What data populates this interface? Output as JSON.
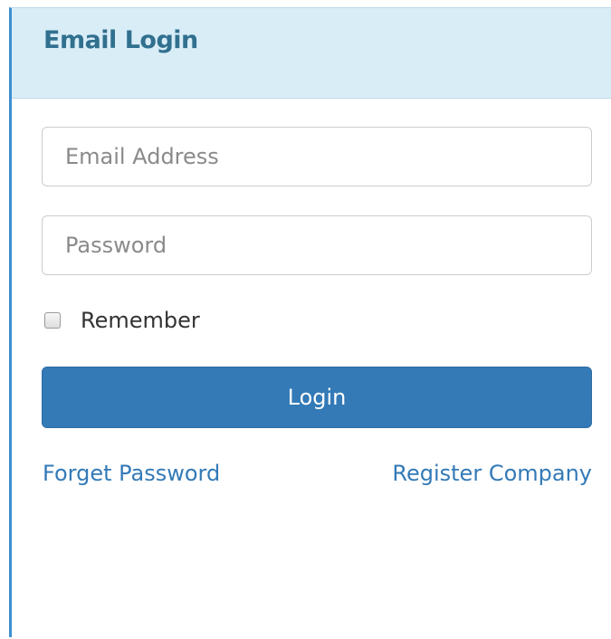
{
  "panel": {
    "title": "Email Login"
  },
  "form": {
    "email_placeholder": "Email Address",
    "password_placeholder": "Password",
    "remember_label": "Remember",
    "remember_checked": false,
    "login_label": "Login"
  },
  "links": {
    "forget_password": "Forget Password",
    "register_company": "Register Company"
  },
  "colors": {
    "heading_background": "#d9edf7",
    "heading_text": "#31708f",
    "primary_button": "#337ab7",
    "link_text": "#337ab7",
    "panel_accent_border": "#3d8fd1"
  }
}
